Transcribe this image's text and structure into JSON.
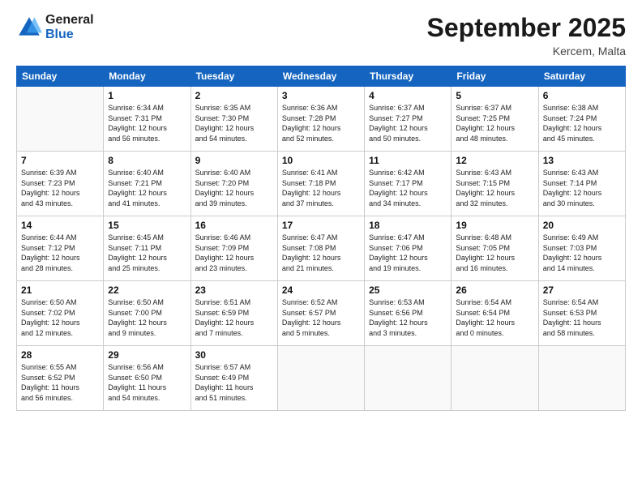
{
  "logo": {
    "line1": "General",
    "line2": "Blue"
  },
  "title": "September 2025",
  "subtitle": "Kercem, Malta",
  "days_of_week": [
    "Sunday",
    "Monday",
    "Tuesday",
    "Wednesday",
    "Thursday",
    "Friday",
    "Saturday"
  ],
  "weeks": [
    [
      {
        "day": "",
        "info": ""
      },
      {
        "day": "1",
        "info": "Sunrise: 6:34 AM\nSunset: 7:31 PM\nDaylight: 12 hours\nand 56 minutes."
      },
      {
        "day": "2",
        "info": "Sunrise: 6:35 AM\nSunset: 7:30 PM\nDaylight: 12 hours\nand 54 minutes."
      },
      {
        "day": "3",
        "info": "Sunrise: 6:36 AM\nSunset: 7:28 PM\nDaylight: 12 hours\nand 52 minutes."
      },
      {
        "day": "4",
        "info": "Sunrise: 6:37 AM\nSunset: 7:27 PM\nDaylight: 12 hours\nand 50 minutes."
      },
      {
        "day": "5",
        "info": "Sunrise: 6:37 AM\nSunset: 7:25 PM\nDaylight: 12 hours\nand 48 minutes."
      },
      {
        "day": "6",
        "info": "Sunrise: 6:38 AM\nSunset: 7:24 PM\nDaylight: 12 hours\nand 45 minutes."
      }
    ],
    [
      {
        "day": "7",
        "info": "Sunrise: 6:39 AM\nSunset: 7:23 PM\nDaylight: 12 hours\nand 43 minutes."
      },
      {
        "day": "8",
        "info": "Sunrise: 6:40 AM\nSunset: 7:21 PM\nDaylight: 12 hours\nand 41 minutes."
      },
      {
        "day": "9",
        "info": "Sunrise: 6:40 AM\nSunset: 7:20 PM\nDaylight: 12 hours\nand 39 minutes."
      },
      {
        "day": "10",
        "info": "Sunrise: 6:41 AM\nSunset: 7:18 PM\nDaylight: 12 hours\nand 37 minutes."
      },
      {
        "day": "11",
        "info": "Sunrise: 6:42 AM\nSunset: 7:17 PM\nDaylight: 12 hours\nand 34 minutes."
      },
      {
        "day": "12",
        "info": "Sunrise: 6:43 AM\nSunset: 7:15 PM\nDaylight: 12 hours\nand 32 minutes."
      },
      {
        "day": "13",
        "info": "Sunrise: 6:43 AM\nSunset: 7:14 PM\nDaylight: 12 hours\nand 30 minutes."
      }
    ],
    [
      {
        "day": "14",
        "info": "Sunrise: 6:44 AM\nSunset: 7:12 PM\nDaylight: 12 hours\nand 28 minutes."
      },
      {
        "day": "15",
        "info": "Sunrise: 6:45 AM\nSunset: 7:11 PM\nDaylight: 12 hours\nand 25 minutes."
      },
      {
        "day": "16",
        "info": "Sunrise: 6:46 AM\nSunset: 7:09 PM\nDaylight: 12 hours\nand 23 minutes."
      },
      {
        "day": "17",
        "info": "Sunrise: 6:47 AM\nSunset: 7:08 PM\nDaylight: 12 hours\nand 21 minutes."
      },
      {
        "day": "18",
        "info": "Sunrise: 6:47 AM\nSunset: 7:06 PM\nDaylight: 12 hours\nand 19 minutes."
      },
      {
        "day": "19",
        "info": "Sunrise: 6:48 AM\nSunset: 7:05 PM\nDaylight: 12 hours\nand 16 minutes."
      },
      {
        "day": "20",
        "info": "Sunrise: 6:49 AM\nSunset: 7:03 PM\nDaylight: 12 hours\nand 14 minutes."
      }
    ],
    [
      {
        "day": "21",
        "info": "Sunrise: 6:50 AM\nSunset: 7:02 PM\nDaylight: 12 hours\nand 12 minutes."
      },
      {
        "day": "22",
        "info": "Sunrise: 6:50 AM\nSunset: 7:00 PM\nDaylight: 12 hours\nand 9 minutes."
      },
      {
        "day": "23",
        "info": "Sunrise: 6:51 AM\nSunset: 6:59 PM\nDaylight: 12 hours\nand 7 minutes."
      },
      {
        "day": "24",
        "info": "Sunrise: 6:52 AM\nSunset: 6:57 PM\nDaylight: 12 hours\nand 5 minutes."
      },
      {
        "day": "25",
        "info": "Sunrise: 6:53 AM\nSunset: 6:56 PM\nDaylight: 12 hours\nand 3 minutes."
      },
      {
        "day": "26",
        "info": "Sunrise: 6:54 AM\nSunset: 6:54 PM\nDaylight: 12 hours\nand 0 minutes."
      },
      {
        "day": "27",
        "info": "Sunrise: 6:54 AM\nSunset: 6:53 PM\nDaylight: 11 hours\nand 58 minutes."
      }
    ],
    [
      {
        "day": "28",
        "info": "Sunrise: 6:55 AM\nSunset: 6:52 PM\nDaylight: 11 hours\nand 56 minutes."
      },
      {
        "day": "29",
        "info": "Sunrise: 6:56 AM\nSunset: 6:50 PM\nDaylight: 11 hours\nand 54 minutes."
      },
      {
        "day": "30",
        "info": "Sunrise: 6:57 AM\nSunset: 6:49 PM\nDaylight: 11 hours\nand 51 minutes."
      },
      {
        "day": "",
        "info": ""
      },
      {
        "day": "",
        "info": ""
      },
      {
        "day": "",
        "info": ""
      },
      {
        "day": "",
        "info": ""
      }
    ]
  ]
}
